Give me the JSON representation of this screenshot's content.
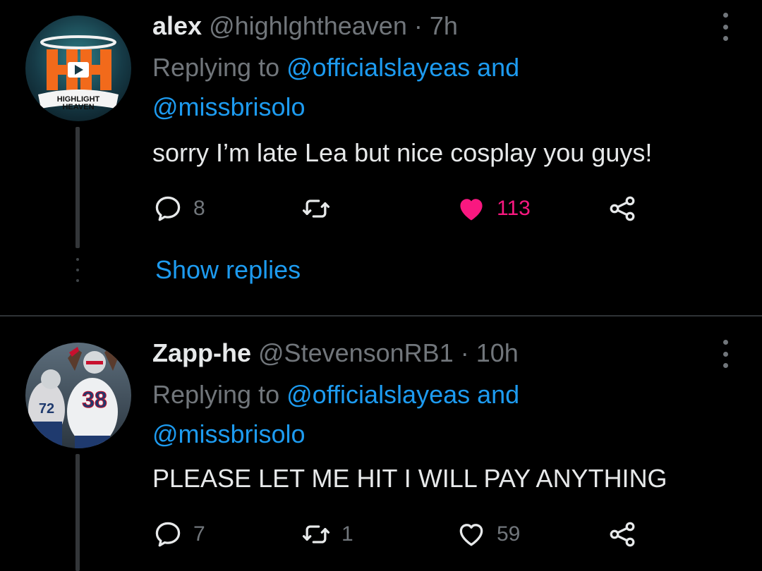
{
  "tweets": [
    {
      "name": "alex",
      "handle": "@highlghtheaven",
      "separator": "·",
      "time": "7h",
      "replying_prefix": "Replying to",
      "mention1": "@officialslayeas",
      "and_word": "and",
      "mention2": "@missbrisolo",
      "text": "sorry I’m late Lea but nice cosplay you guys!",
      "avatar_label": "HIGHLIGHT HEAVEN",
      "replies": "8",
      "retweets": "",
      "likes": "113",
      "liked": true,
      "show_replies": "Show replies"
    },
    {
      "name": "Zapp-he",
      "handle": "@StevensonRB1",
      "separator": "·",
      "time": "10h",
      "replying_prefix": "Replying to",
      "mention1": "@officialslayeas",
      "and_word": "and",
      "mention2": "@missbrisolo",
      "text": "PLEASE LET ME HIT I WILL PAY ANYTHING",
      "avatar_jersey_number": "38",
      "avatar_jersey_number_2": "72",
      "replies": "7",
      "retweets": "1",
      "likes": "59",
      "liked": false
    }
  ],
  "colors": {
    "background": "#000000",
    "text": "#e7e9ea",
    "muted": "#71767b",
    "link": "#1d9bf0",
    "like": "#f91880",
    "divider": "#2f3336"
  },
  "icons": [
    "reply-icon",
    "retweet-icon",
    "heart-icon",
    "share-icon",
    "more-icon"
  ]
}
